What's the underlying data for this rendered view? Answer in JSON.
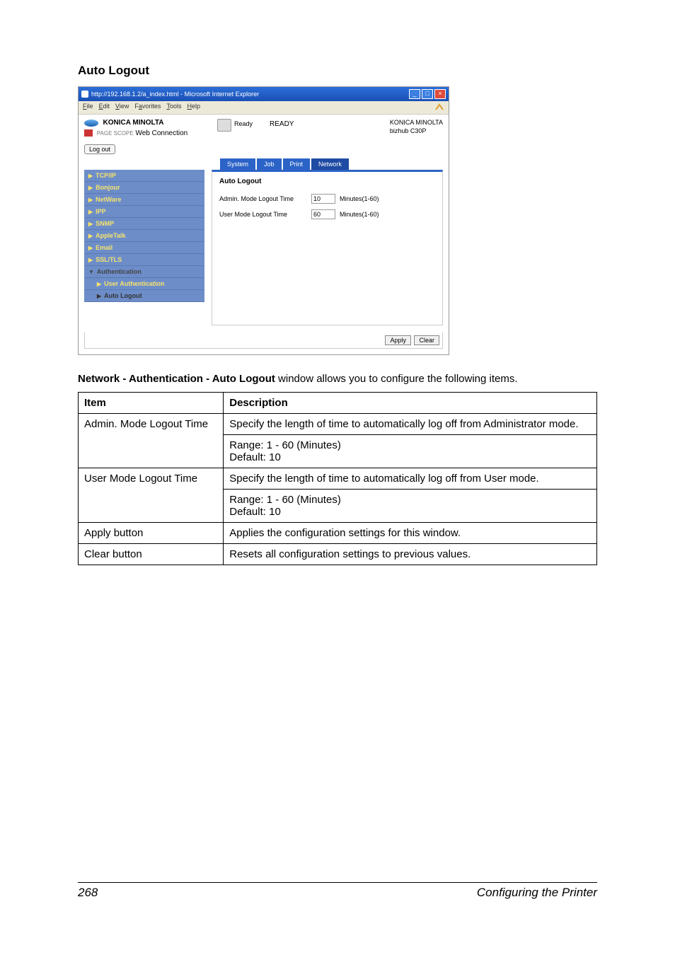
{
  "section_heading": "Auto Logout",
  "browser": {
    "title": "http://192.168.1.2/a_index.html - Microsoft Internet Explorer",
    "menubar": {
      "file": "File",
      "edit": "Edit",
      "view": "View",
      "favorites": "Favorites",
      "tools": "Tools",
      "help": "Help"
    },
    "brand": "KONICA MINOLTA",
    "pagescope_prefix": "PAGE SCOPE",
    "webconnection": "Web Connection",
    "status_ready_label": "Ready",
    "status_ready_big": "READY",
    "device_brand": "KONICA MINOLTA",
    "device_model": "bizhub C30P",
    "logout_btn": "Log out",
    "tabs": {
      "system": "System",
      "job": "Job",
      "print": "Print",
      "network": "Network"
    },
    "sidebar": {
      "tcpip": "TCP/IP",
      "bonjour": "Bonjour",
      "netware": "NetWare",
      "ipp": "IPP",
      "snmp": "SNMP",
      "appletalk": "AppleTalk",
      "email": "Email",
      "ssltls": "SSL/TLS",
      "authentication": "Authentication",
      "user_auth": "User Authentication",
      "auto_logout": "Auto Logout"
    },
    "panel": {
      "title": "Auto Logout",
      "admin_label": "Admin. Mode Logout Time",
      "admin_value": "10",
      "admin_unit": "Minutes(1-60)",
      "user_label": "User Mode Logout Time",
      "user_value": "60",
      "user_unit": "Minutes(1-60)"
    },
    "buttons": {
      "apply": "Apply",
      "clear": "Clear"
    }
  },
  "caption": {
    "bold": "Network - Authentication - Auto Logout",
    "rest": " window allows you to configure the following items."
  },
  "table": {
    "head_item": "Item",
    "head_desc": "Description",
    "rows": [
      {
        "item": "Admin. Mode Logout Time",
        "desc1": "Specify the length of time to automatically log off from Administrator mode.",
        "range": "Range:   1 - 60 (Minutes)",
        "default": "Default:  10"
      },
      {
        "item": "User Mode Logout Time",
        "desc1": "Specify the length of time to automatically log off from User mode.",
        "range": "Range:   1 - 60 (Minutes)",
        "default": "Default:  10"
      },
      {
        "item": "Apply button",
        "desc1": "Applies the configuration settings for this window."
      },
      {
        "item": "Clear button",
        "desc1": "Resets all configuration settings to previous values."
      }
    ]
  },
  "footer": {
    "page": "268",
    "title": "Configuring the Printer"
  }
}
